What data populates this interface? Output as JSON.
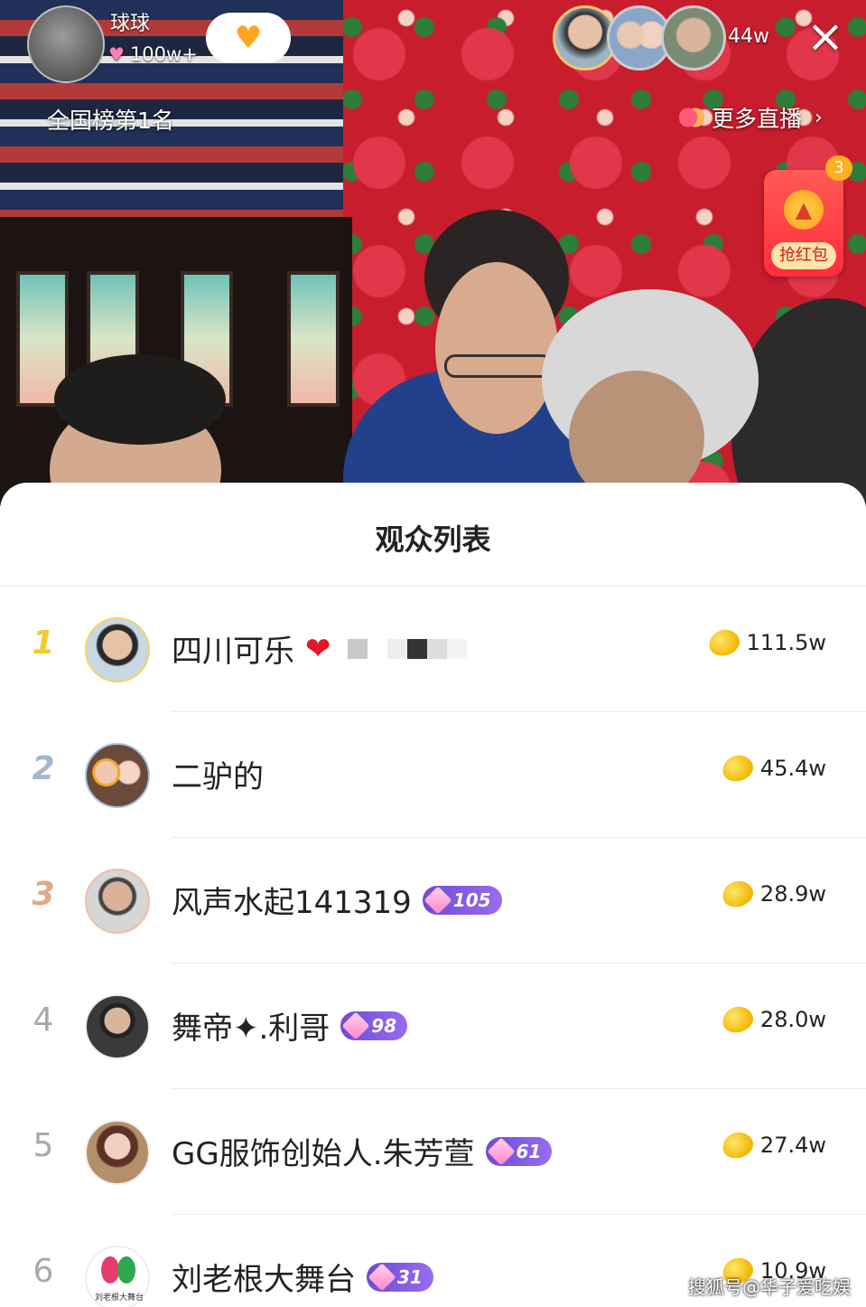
{
  "stream": {
    "host_name": "球球",
    "host_likes": "100w+",
    "rank_text": "全国榜第1名",
    "viewer_count": "44w",
    "more_live_label": "更多直播",
    "red_packet_label": "抢红包",
    "red_packet_count": "3",
    "close_icon": "close-icon"
  },
  "panel": {
    "title": "观众列表"
  },
  "viewers": [
    {
      "rank": "1",
      "name": "四川可乐",
      "level": "",
      "coins": "111.5w",
      "style": "gold"
    },
    {
      "rank": "2",
      "name": "二驴的",
      "level": "",
      "coins": "45.4w",
      "style": "silver"
    },
    {
      "rank": "3",
      "name": "风声水起141319",
      "level": "105",
      "coins": "28.9w",
      "style": "bronze"
    },
    {
      "rank": "4",
      "name": "舞帝✦.利哥",
      "level": "98",
      "coins": "28.0w",
      "style": "plain"
    },
    {
      "rank": "5",
      "name": "GG服饰创始人.朱芳萱",
      "level": "61",
      "coins": "27.4w",
      "style": "plain"
    },
    {
      "rank": "6",
      "name": "刘老根大舞台",
      "level": "31",
      "coins": "10.9w",
      "style": "plain"
    }
  ],
  "avatar6_caption": "刘老根大舞台",
  "watermark": "搜狐号@华子爱吃娱",
  "colors": {
    "rank_gold": "#f2cc2d",
    "rank_silver": "#9fb7cf",
    "rank_bronze": "#e0a98a",
    "level_badge": "#7b57e0",
    "coin": "#f2b705"
  }
}
